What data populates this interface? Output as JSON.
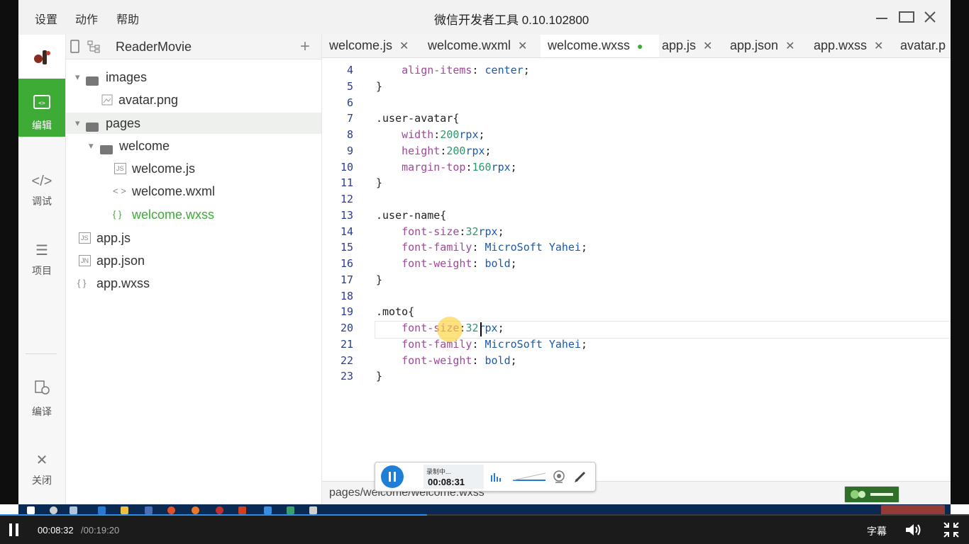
{
  "titlebar": {
    "menus": [
      "设置",
      "动作",
      "帮助"
    ],
    "title": "微信开发者工具 0.10.102800"
  },
  "rail": {
    "items": [
      {
        "label": "编辑",
        "icon": "code-icon",
        "active": true
      },
      {
        "label": "调试",
        "icon": "debug-icon",
        "active": false
      },
      {
        "label": "项目",
        "icon": "menu-icon",
        "active": false
      },
      {
        "label": "编译",
        "icon": "compile-icon",
        "active": false
      },
      {
        "label": "关闭",
        "icon": "close-icon",
        "active": false
      }
    ]
  },
  "explorer": {
    "project_name": "ReaderMovie",
    "tree": [
      {
        "label": "images",
        "type": "folder"
      },
      {
        "label": "avatar.png",
        "type": "image"
      },
      {
        "label": "pages",
        "type": "folder"
      },
      {
        "label": "welcome",
        "type": "folder"
      },
      {
        "label": "welcome.js",
        "type": "js",
        "icon_text": "JS"
      },
      {
        "label": "welcome.wxml",
        "type": "wxml",
        "icon_text": "< >"
      },
      {
        "label": "welcome.wxss",
        "type": "wxss",
        "icon_text": "{ }",
        "active": true
      },
      {
        "label": "app.js",
        "type": "js",
        "icon_text": "JS"
      },
      {
        "label": "app.json",
        "type": "json",
        "icon_text": "JN"
      },
      {
        "label": "app.wxss",
        "type": "wxss",
        "icon_text": "{ }"
      }
    ]
  },
  "tabs": [
    {
      "label": "welcome.js",
      "active": false
    },
    {
      "label": "welcome.wxml",
      "active": false
    },
    {
      "label": "welcome.wxss",
      "active": true,
      "modified": true
    },
    {
      "label": "app.js",
      "active": false
    },
    {
      "label": "app.json",
      "active": false
    },
    {
      "label": "app.wxss",
      "active": false
    },
    {
      "label": "avatar.p",
      "active": false
    }
  ],
  "code": {
    "lines": [
      {
        "n": "4",
        "segs": [
          [
            "i",
            "    "
          ],
          [
            "p",
            "align-items"
          ],
          [
            "t",
            ": "
          ],
          [
            "v",
            "center"
          ],
          [
            "t",
            ";"
          ]
        ]
      },
      {
        "n": "5",
        "segs": [
          [
            "t",
            "}"
          ]
        ]
      },
      {
        "n": "6",
        "segs": []
      },
      {
        "n": "7",
        "segs": [
          [
            "t",
            ".user-avatar{"
          ]
        ]
      },
      {
        "n": "8",
        "segs": [
          [
            "i",
            "    "
          ],
          [
            "p",
            "width"
          ],
          [
            "t",
            ":"
          ],
          [
            "n",
            "200"
          ],
          [
            "u",
            "rpx"
          ],
          [
            "t",
            ";"
          ]
        ]
      },
      {
        "n": "9",
        "segs": [
          [
            "i",
            "    "
          ],
          [
            "p",
            "height"
          ],
          [
            "t",
            ":"
          ],
          [
            "n",
            "200"
          ],
          [
            "u",
            "rpx"
          ],
          [
            "t",
            ";"
          ]
        ]
      },
      {
        "n": "10",
        "segs": [
          [
            "i",
            "    "
          ],
          [
            "p",
            "margin-top"
          ],
          [
            "t",
            ":"
          ],
          [
            "n",
            "160"
          ],
          [
            "u",
            "rpx"
          ],
          [
            "t",
            ";"
          ]
        ]
      },
      {
        "n": "11",
        "segs": [
          [
            "t",
            "}"
          ]
        ]
      },
      {
        "n": "12",
        "segs": []
      },
      {
        "n": "13",
        "segs": [
          [
            "t",
            ".user-name{"
          ]
        ]
      },
      {
        "n": "14",
        "segs": [
          [
            "i",
            "    "
          ],
          [
            "p",
            "font-size"
          ],
          [
            "t",
            ":"
          ],
          [
            "n",
            "32"
          ],
          [
            "u",
            "rpx"
          ],
          [
            "t",
            ";"
          ]
        ]
      },
      {
        "n": "15",
        "segs": [
          [
            "i",
            "    "
          ],
          [
            "p",
            "font-family"
          ],
          [
            "t",
            ": "
          ],
          [
            "v",
            "MicroSoft Yahei"
          ],
          [
            "t",
            ";"
          ]
        ]
      },
      {
        "n": "16",
        "segs": [
          [
            "i",
            "    "
          ],
          [
            "p",
            "font-weight"
          ],
          [
            "t",
            ": "
          ],
          [
            "v",
            "bold"
          ],
          [
            "t",
            ";"
          ]
        ]
      },
      {
        "n": "17",
        "segs": [
          [
            "t",
            "}"
          ]
        ]
      },
      {
        "n": "18",
        "segs": []
      },
      {
        "n": "19",
        "segs": [
          [
            "t",
            ".moto{"
          ]
        ]
      },
      {
        "n": "20",
        "segs": [
          [
            "i",
            "    "
          ],
          [
            "p",
            "font-size"
          ],
          [
            "t",
            ":"
          ],
          [
            "n",
            "32"
          ],
          [
            "u",
            "rpx"
          ],
          [
            "t",
            ";"
          ]
        ]
      },
      {
        "n": "21",
        "segs": [
          [
            "i",
            "    "
          ],
          [
            "p",
            "font-family"
          ],
          [
            "t",
            ": "
          ],
          [
            "v",
            "MicroSoft Yahei"
          ],
          [
            "t",
            ";"
          ]
        ]
      },
      {
        "n": "22",
        "segs": [
          [
            "i",
            "    "
          ],
          [
            "p",
            "font-weight"
          ],
          [
            "t",
            ": "
          ],
          [
            "v",
            "bold"
          ],
          [
            "t",
            ";"
          ]
        ]
      },
      {
        "n": "23",
        "segs": [
          [
            "t",
            "}"
          ]
        ]
      }
    ]
  },
  "statusbar": {
    "path": "pages/welcome/welcome.wxss"
  },
  "recorder": {
    "status": "录制中...",
    "time": "00:08:31"
  },
  "player": {
    "current": "00:08:32",
    "total": "/00:19:20",
    "subtitle_label": "字幕",
    "progress": 0.441,
    "accent": "#2d8ce6"
  },
  "colors": {
    "accent_green": "#3eab37"
  }
}
